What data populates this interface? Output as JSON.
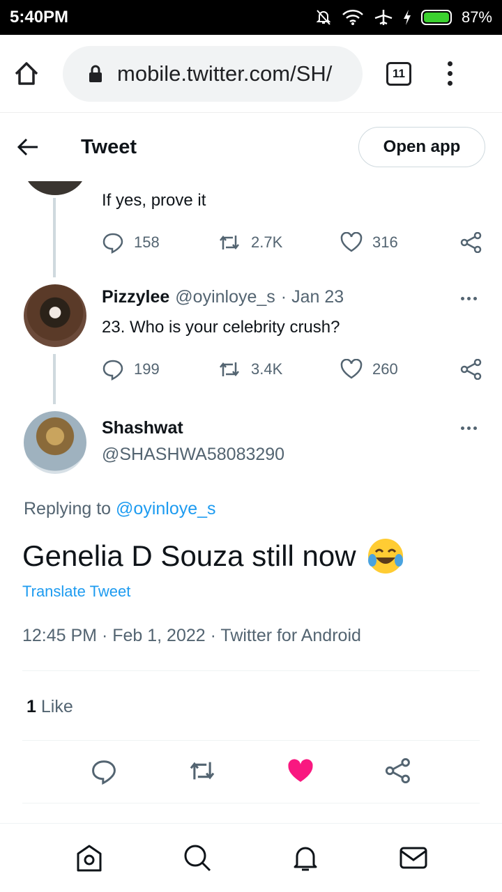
{
  "status": {
    "time": "5:40PM",
    "battery": "87%"
  },
  "browser": {
    "url": "mobile.twitter.com/SH/",
    "tab_count": "11"
  },
  "header": {
    "title": "Tweet",
    "open_app": "Open app"
  },
  "prev_tweet": {
    "text": "If yes, prove it",
    "replies": "158",
    "retweets": "2.7K",
    "likes": "316"
  },
  "parent_tweet": {
    "name": "Pizzylee",
    "handle": "@oyinloye_s",
    "date": "· Jan 23",
    "text": "23. Who is your celebrity crush?",
    "replies": "199",
    "retweets": "3.4K",
    "likes": "260"
  },
  "main_tweet": {
    "name": "Shashwat",
    "handle": "@SHASHWA58083290",
    "replying_prefix": "Replying to",
    "replying_handle": "@oyinloye_s",
    "text": "Genelia D Souza still now",
    "translate": "Translate Tweet",
    "meta": "12:45 PM · Feb 1, 2022 · Twitter for Android",
    "like_count": "1",
    "like_label": "Like"
  },
  "colors": {
    "accent": "#1d9bf0",
    "like": "#f91880",
    "muted": "#536471"
  },
  "nav": [
    "home-icon",
    "search-icon",
    "notifications-icon",
    "messages-icon"
  ]
}
